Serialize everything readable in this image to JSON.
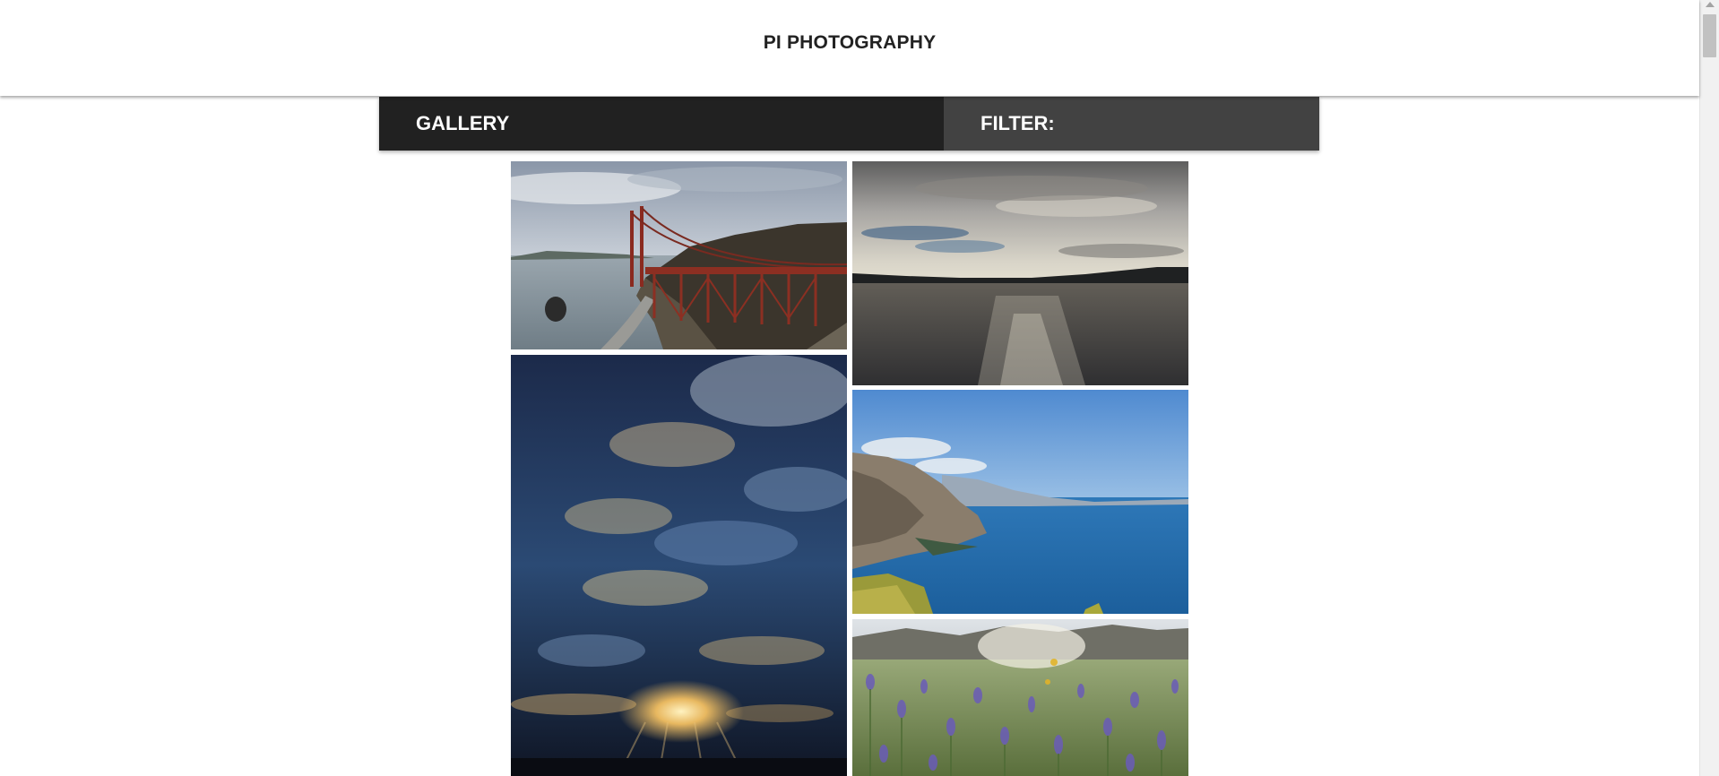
{
  "header": {
    "title": "PI PHOTOGRAPHY"
  },
  "nav": {
    "gallery_label": "GALLERY",
    "filter_label": "FILTER:"
  },
  "gallery": {
    "photos": [
      {
        "subject": "Golden Gate Bridge and coastline"
      },
      {
        "subject": "Bay with cloudy sky"
      },
      {
        "subject": "Dramatic clouds with sunset"
      },
      {
        "subject": "Rocky coastline with blue ocean"
      },
      {
        "subject": "Field of purple wildflowers"
      }
    ]
  },
  "colors": {
    "nav_gallery_bg": "#212121",
    "nav_filter_bg": "#424242",
    "page_bg": "#ffffff"
  }
}
